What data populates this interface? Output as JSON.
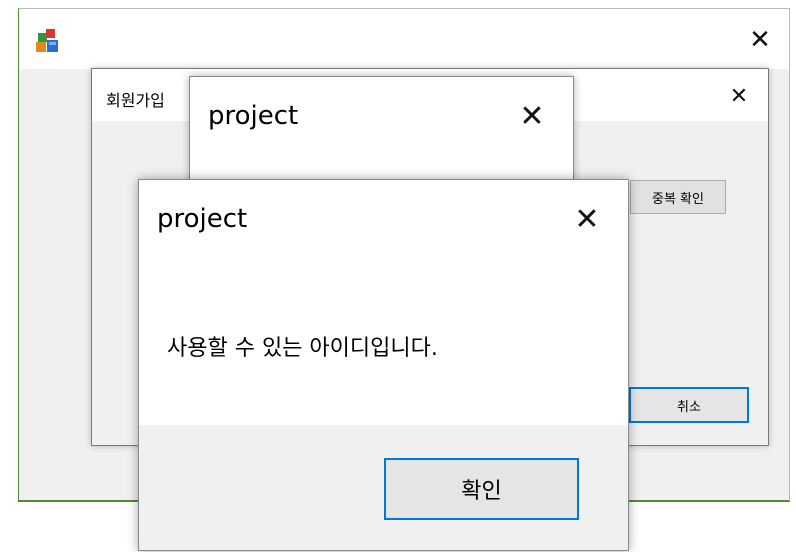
{
  "main_window": {
    "icon": "app-cubes-icon",
    "close_icon": "close-icon",
    "close_glyph": "✕"
  },
  "signup_window": {
    "title": "회원가입",
    "close_glyph": "✕",
    "dup_check_label": "중복 확인",
    "cancel_label": "취소"
  },
  "dialog_back": {
    "title": "project",
    "close_glyph": "✕"
  },
  "dialog_front": {
    "title": "project",
    "close_glyph": "✕",
    "message": "사용할 수 있는 아이디입니다.",
    "ok_label": "확인"
  },
  "colors": {
    "accent_border": "#0078d7",
    "window_bg": "#f0f0f0",
    "main_window_edge": "#4f8c3a"
  }
}
